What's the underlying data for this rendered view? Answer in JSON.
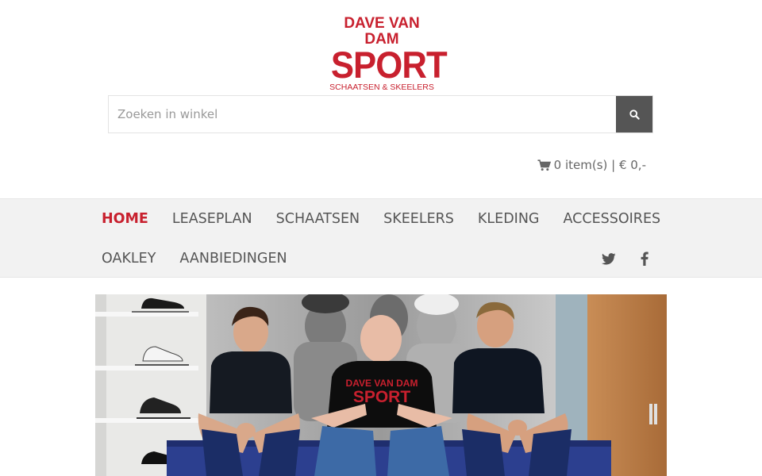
{
  "logo": {
    "line1": "DAVE VAN DAM",
    "line2": "SPORT",
    "line3": "SCHAATSEN & SKEELERS"
  },
  "search": {
    "placeholder": "Zoeken in winkel"
  },
  "cart": {
    "text": "0 item(s) | € 0,-"
  },
  "nav": {
    "row1": [
      "HOME",
      "LEASEPLAN",
      "SCHAATSEN",
      "SKEELERS",
      "KLEDING",
      "ACCESSOIRES"
    ],
    "row2": [
      "OAKLEY",
      "AANBIEDINGEN"
    ]
  },
  "hero": {
    "shirt_line1": "DAVE VAN DAM",
    "shirt_line2": "SPORT"
  },
  "colors": {
    "brand": "#c8202e",
    "nav_bg": "#f2f2f2",
    "search_button": "#555555"
  },
  "icons": [
    "search-icon",
    "cart-icon",
    "twitter-icon",
    "facebook-icon"
  ]
}
